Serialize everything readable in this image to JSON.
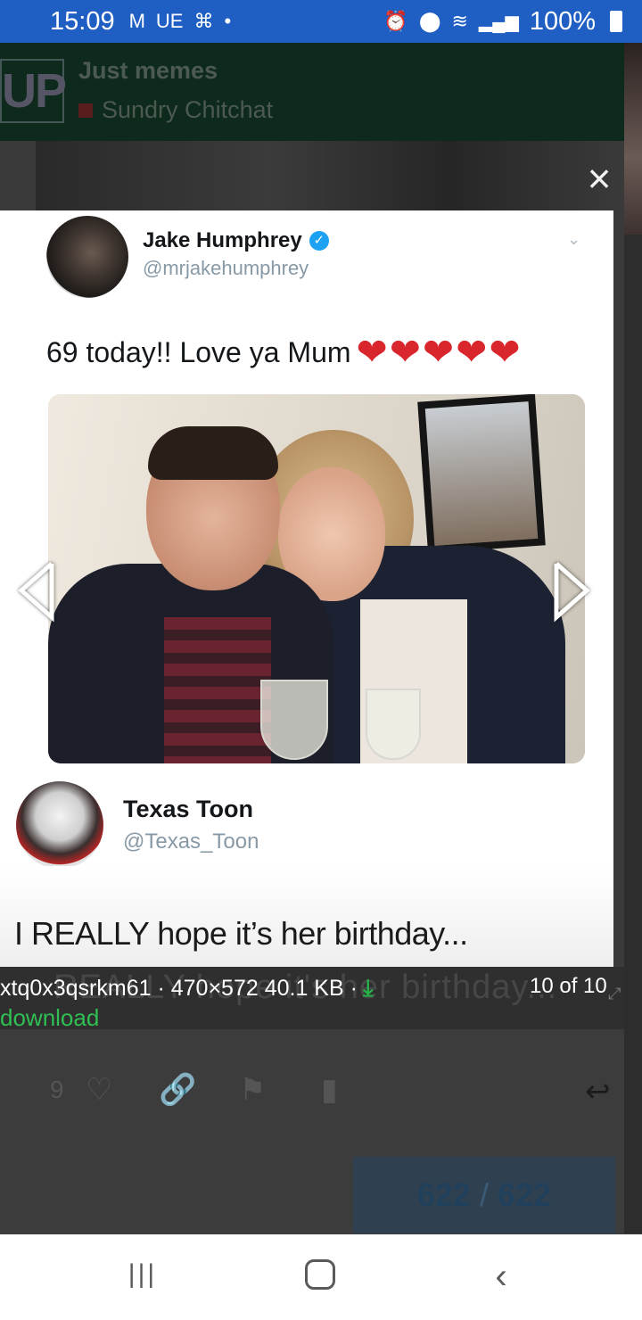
{
  "status_bar": {
    "time": "15:09",
    "left_icons": [
      "M",
      "UE",
      "⌘",
      "•"
    ],
    "battery": "100%"
  },
  "forum": {
    "logo": "UP",
    "title": "Just memes",
    "category": "Sundry Chitchat",
    "category_color": "#5a1d1d"
  },
  "lightbox": {
    "close_symbol": "×",
    "tweet1": {
      "name": "Jake Humphrey",
      "handle": "@mrjakehumphrey",
      "text": "69 today!! Love ya Mum",
      "hearts": [
        "❤",
        "❤",
        "❤",
        "❤",
        "❤"
      ]
    },
    "tweet2": {
      "name": "Texas Toon",
      "handle": "@Texas_Toon",
      "text": "I REALLY hope it’s her birthday..."
    },
    "caption": {
      "ghost_text": "REALLY hope it's her birthday...",
      "file_info": "xtq0x3qsrkm61 · 470×572 40.1 KB ·",
      "download_label": "download",
      "counter": "10 of 10"
    }
  },
  "post_actions": {
    "like_count": "9",
    "progress_current": "622",
    "progress_separator": "/",
    "progress_total": "622"
  },
  "colors": {
    "status_bar_bg": "#1f5fc4",
    "download_green": "#2fbf52",
    "heart_red": "#d9262c",
    "verified_blue": "#1da1f2"
  },
  "icons": [
    "heart-icon",
    "link-icon",
    "flag-icon",
    "bookmark-icon",
    "reply-icon",
    "download-icon",
    "verified-icon",
    "close-icon",
    "arrow-left-icon",
    "arrow-right-icon"
  ]
}
